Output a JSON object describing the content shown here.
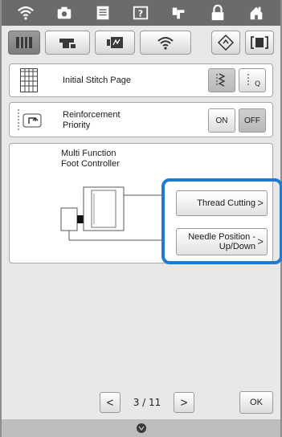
{
  "topbar": {
    "icons": [
      "wifi-icon",
      "camera-icon",
      "document-icon",
      "help-icon",
      "embroidery-icon",
      "lock-icon",
      "home-icon"
    ]
  },
  "tabs": {
    "icons": [
      "sewing-settings-icon",
      "machine-settings-icon",
      "embroidery-settings-icon",
      "wireless-icon",
      "info-icon",
      "fullscreen-icon"
    ]
  },
  "settings": {
    "initial_stitch_page": {
      "label": "Initial Stitch Page"
    },
    "reinforcement": {
      "label": "Reinforcement\nPriority",
      "on_label": "ON",
      "off_label": "OFF",
      "selected": "OFF"
    },
    "foot_controller": {
      "label": "Multi Function\nFoot Controller",
      "thread_cutting_label": "Thread Cutting",
      "needle_position_label": "Needle Position -\nUp/Down"
    }
  },
  "pager": {
    "text": "3 / 11",
    "prev": "<",
    "next": ">"
  },
  "ok_label": "OK",
  "colors": {
    "highlight": "#1e7bd2",
    "topbar": "#6b6b6b"
  }
}
